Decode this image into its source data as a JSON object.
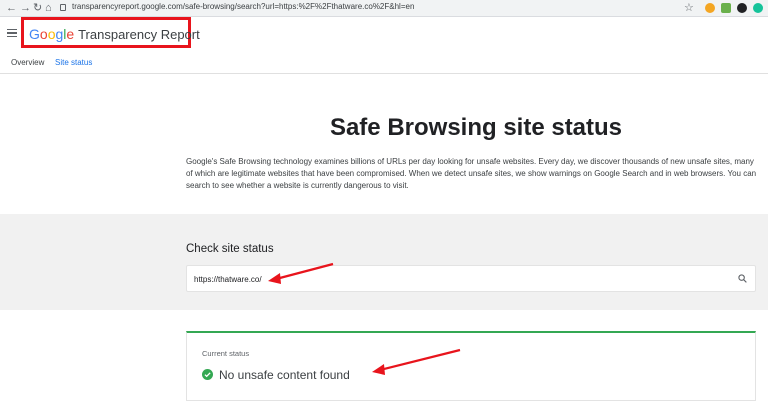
{
  "browser": {
    "url": "transparencyreport.google.com/safe-browsing/search?url=https:%2F%2Fthatware.co%2F&hl=en"
  },
  "header": {
    "logo_google": [
      "G",
      "o",
      "o",
      "g",
      "l",
      "e"
    ],
    "logo_rest": "Transparency Report"
  },
  "tabs": [
    {
      "label": "Overview"
    },
    {
      "label": "Site status"
    }
  ],
  "main": {
    "title": "Safe Browsing site status",
    "description": "Google's Safe Browsing technology examines billions of URLs per day looking for unsafe websites. Every day, we discover thousands of new unsafe sites, many of which are legitimate websites that have been compromised. When we detect unsafe sites, we show warnings on Google Search and in web browsers. You can search to see whether a website is currently dangerous to visit."
  },
  "check": {
    "label": "Check site status",
    "value": "https://thatware.co/"
  },
  "status": {
    "label": "Current status",
    "text": "No unsafe content found"
  },
  "colors": {
    "accent": "#1a73e8",
    "ok": "#34a853",
    "annotation": "#e8141c"
  }
}
